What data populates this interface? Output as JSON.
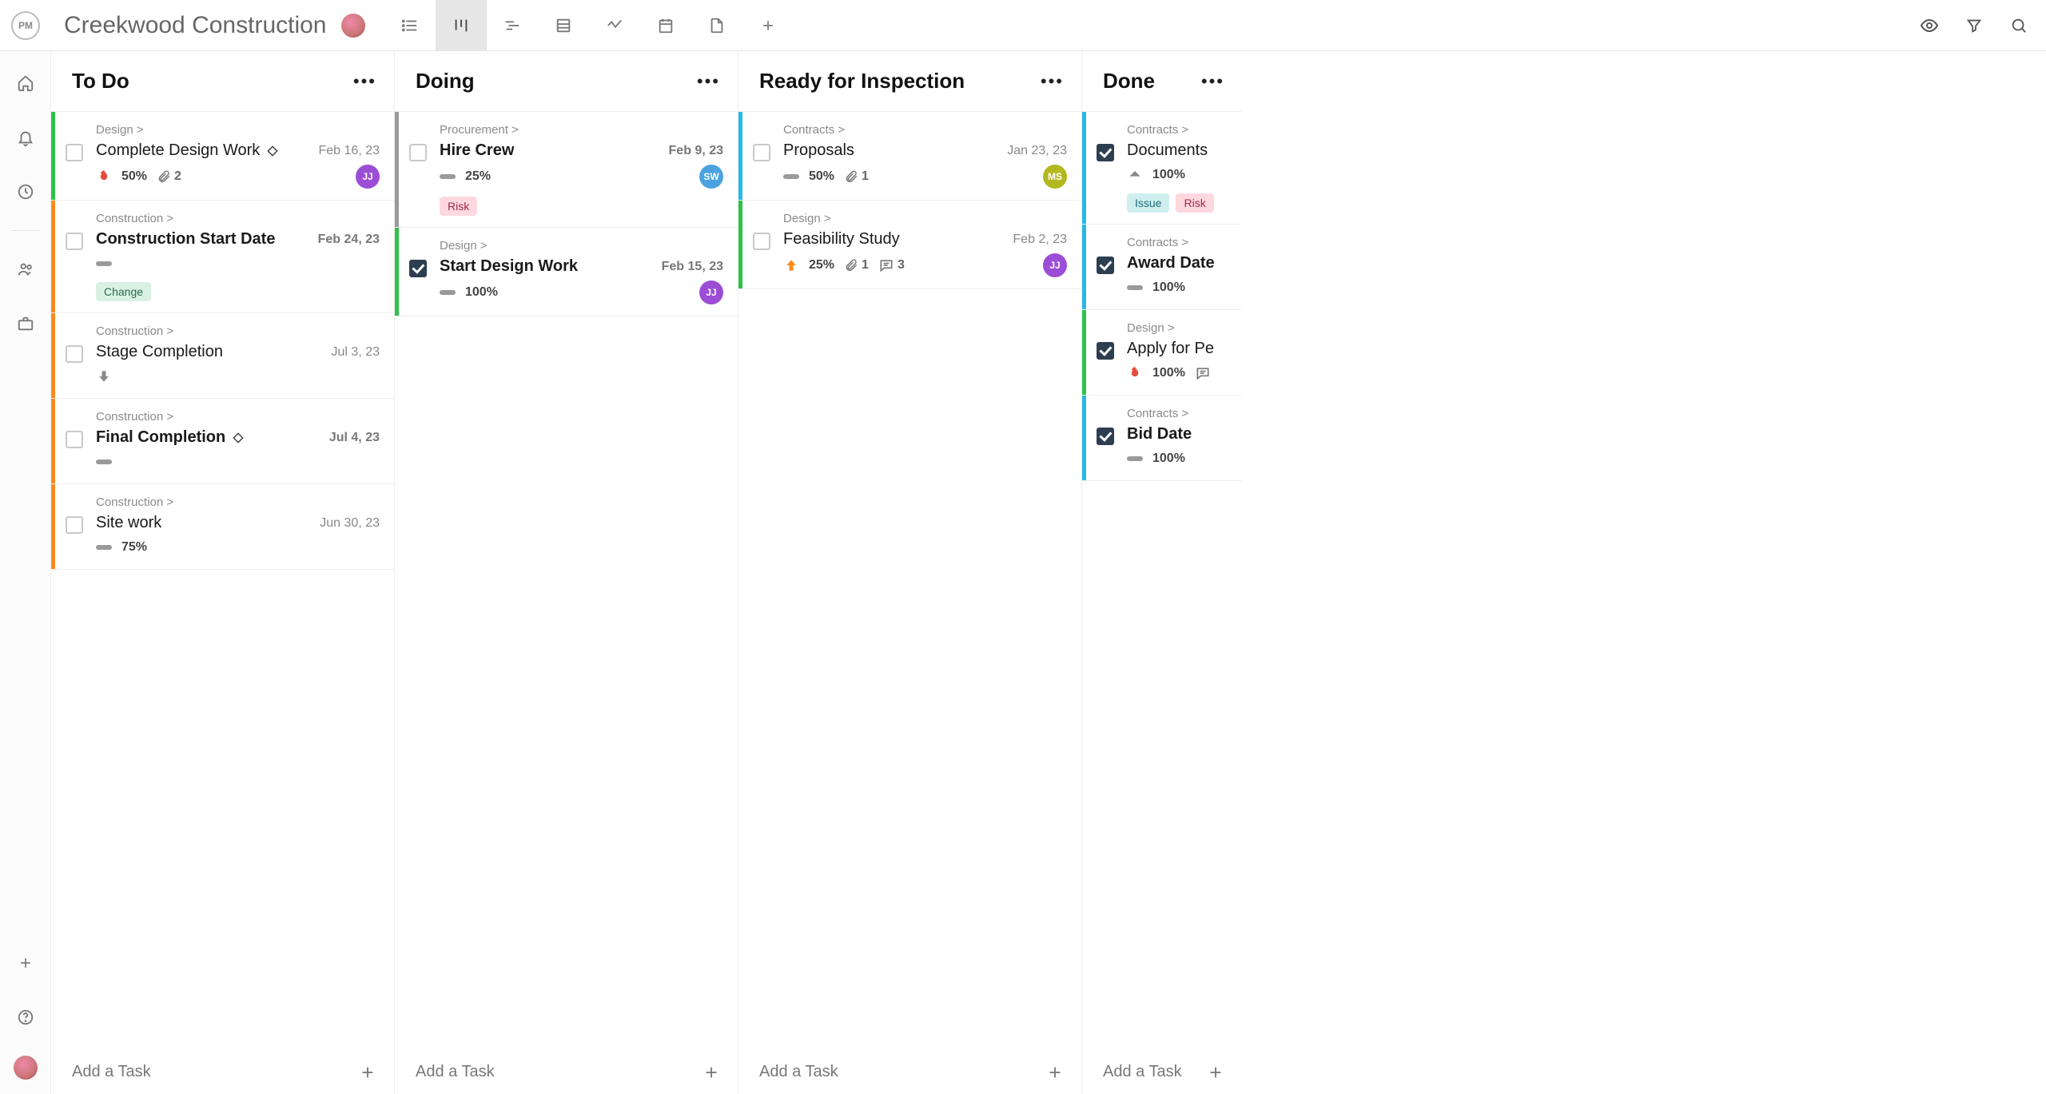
{
  "project_title": "Creekwood Construction",
  "add_task_label": "Add a Task",
  "columns": [
    {
      "title": "To Do",
      "cards": [
        {
          "stripe": "green",
          "done": false,
          "breadcrumb": "Design >",
          "title": "Complete Design Work",
          "milestone": true,
          "bold_title": false,
          "date": "Feb 16, 23",
          "bold_date": false,
          "priority": "fire",
          "percent": "50%",
          "attachments": "2",
          "comments": null,
          "avatar": {
            "type": "initials",
            "text": "JJ",
            "bg": "#9b4dd6"
          },
          "tags": []
        },
        {
          "stripe": "orange",
          "done": false,
          "breadcrumb": "Construction >",
          "title": "Construction Start Date",
          "milestone": false,
          "bold_title": true,
          "date": "Feb 24, 23",
          "bold_date": true,
          "priority": "dash",
          "percent": null,
          "attachments": null,
          "comments": null,
          "avatar": null,
          "tags": [
            "Change"
          ]
        },
        {
          "stripe": "orange",
          "done": false,
          "breadcrumb": "Construction >",
          "title": "Stage Completion",
          "milestone": false,
          "bold_title": false,
          "date": "Jul 3, 23",
          "bold_date": false,
          "priority": "down",
          "percent": null,
          "attachments": null,
          "comments": null,
          "avatar": null,
          "tags": []
        },
        {
          "stripe": "orange",
          "done": false,
          "breadcrumb": "Construction >",
          "title": "Final Completion",
          "milestone": true,
          "bold_title": true,
          "date": "Jul 4, 23",
          "bold_date": true,
          "priority": "dash",
          "percent": null,
          "attachments": null,
          "comments": null,
          "avatar": null,
          "tags": []
        },
        {
          "stripe": "orange",
          "done": false,
          "breadcrumb": "Construction >",
          "title": "Site work",
          "milestone": false,
          "bold_title": false,
          "date": "Jun 30, 23",
          "bold_date": false,
          "priority": "dash",
          "percent": "75%",
          "attachments": null,
          "comments": null,
          "avatar": null,
          "tags": []
        }
      ]
    },
    {
      "title": "Doing",
      "cards": [
        {
          "stripe": "grey",
          "done": false,
          "breadcrumb": "Procurement >",
          "title": "Hire Crew",
          "milestone": false,
          "bold_title": true,
          "date": "Feb 9, 23",
          "bold_date": true,
          "priority": "dash",
          "percent": "25%",
          "attachments": null,
          "comments": null,
          "avatar": {
            "type": "initials",
            "text": "SW",
            "bg": "#4aa3e0"
          },
          "tags": [
            "Risk"
          ]
        },
        {
          "stripe": "green",
          "done": true,
          "breadcrumb": "Design >",
          "title": "Start Design Work",
          "milestone": false,
          "bold_title": true,
          "date": "Feb 15, 23",
          "bold_date": true,
          "priority": "dash",
          "percent": "100%",
          "attachments": null,
          "comments": null,
          "avatar": {
            "type": "initials",
            "text": "JJ",
            "bg": "#9b4dd6"
          },
          "tags": []
        }
      ]
    },
    {
      "title": "Ready for Inspection",
      "cards": [
        {
          "stripe": "blue",
          "done": false,
          "breadcrumb": "Contracts >",
          "title": "Proposals",
          "milestone": false,
          "bold_title": false,
          "date": "Jan 23, 23",
          "bold_date": false,
          "priority": "dash",
          "percent": "50%",
          "attachments": "1",
          "comments": null,
          "avatar": {
            "type": "initials",
            "text": "MS",
            "bg": "#b4b81f"
          },
          "tags": []
        },
        {
          "stripe": "green",
          "done": false,
          "breadcrumb": "Design >",
          "title": "Feasibility Study",
          "milestone": false,
          "bold_title": false,
          "date": "Feb 2, 23",
          "bold_date": false,
          "priority": "up",
          "percent": "25%",
          "attachments": "1",
          "comments": "3",
          "avatar": {
            "type": "initials",
            "text": "JJ",
            "bg": "#9b4dd6"
          },
          "tags": []
        }
      ]
    },
    {
      "title": "Done",
      "cards": [
        {
          "stripe": "blue",
          "done": true,
          "breadcrumb": "Contracts >",
          "title": "Documents",
          "milestone": false,
          "bold_title": false,
          "date": "",
          "bold_date": false,
          "priority": "up-grey",
          "percent": "100%",
          "attachments": null,
          "comments": null,
          "avatar": null,
          "tags": [
            "Issue",
            "Risk"
          ]
        },
        {
          "stripe": "blue",
          "done": true,
          "breadcrumb": "Contracts >",
          "title": "Award Date",
          "milestone": false,
          "bold_title": true,
          "date": "",
          "bold_date": false,
          "priority": "dash",
          "percent": "100%",
          "attachments": null,
          "comments": null,
          "avatar": null,
          "tags": []
        },
        {
          "stripe": "green",
          "done": true,
          "breadcrumb": "Design >",
          "title": "Apply for Pe",
          "milestone": false,
          "bold_title": false,
          "date": "",
          "bold_date": false,
          "priority": "fire",
          "percent": "100%",
          "attachments": null,
          "comments": "",
          "avatar": null,
          "tags": []
        },
        {
          "stripe": "blue",
          "done": true,
          "breadcrumb": "Contracts >",
          "title": "Bid Date",
          "milestone": false,
          "bold_title": true,
          "date": "",
          "bold_date": false,
          "priority": "dash",
          "percent": "100%",
          "attachments": null,
          "comments": null,
          "avatar": null,
          "tags": []
        }
      ]
    }
  ]
}
